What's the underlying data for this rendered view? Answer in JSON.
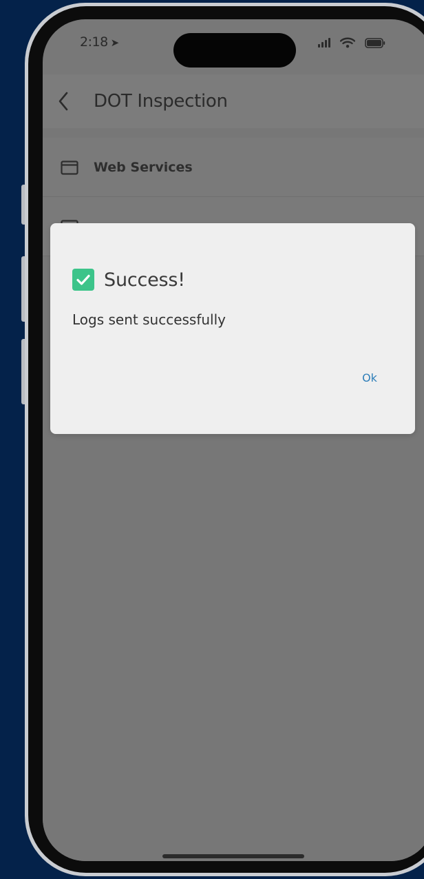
{
  "status_bar": {
    "time": "2:18",
    "location_arrow": "➤"
  },
  "header": {
    "title": "DOT Inspection",
    "back_icon": "chevron-left-icon"
  },
  "list": {
    "items": [
      {
        "label": "Web Services",
        "icon": "calendar-icon"
      },
      {
        "label": "",
        "icon": "calendar-icon"
      }
    ]
  },
  "dialog": {
    "title": "Success!",
    "message": "Logs sent successfully",
    "ok_label": "Ok",
    "icon": "check-icon",
    "accent_color": "#3cc48a",
    "button_color": "#2f7fb9"
  }
}
